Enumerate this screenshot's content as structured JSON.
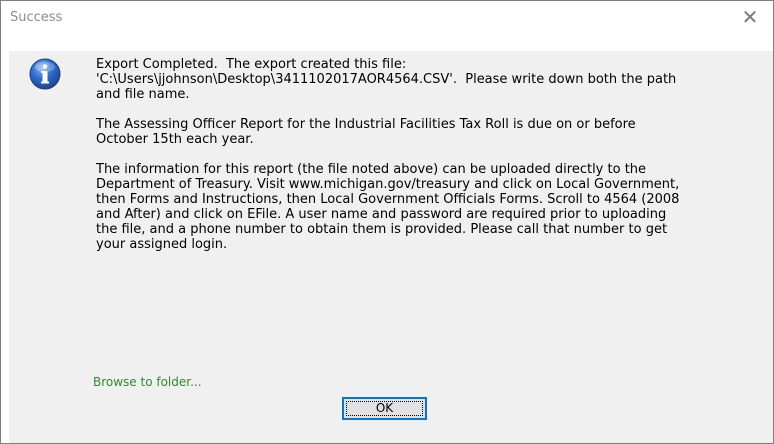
{
  "window": {
    "title": "Success",
    "close_glyph": "✕"
  },
  "icon": "information-icon",
  "message": {
    "paragraph1": "Export Completed.  The export created this file:\n'C:\\Users\\jjohnson\\Desktop\\3411102017AOR4564.CSV'.  Please write down both the path\nand file name.",
    "paragraph2": "The Assessing Officer Report for the Industrial Facilities Tax Roll is due on or before\nOctober 15th each year.",
    "paragraph3": "The information for this report (the file noted above) can be uploaded directly to the\nDepartment of Treasury. Visit www.michigan.gov/treasury and click on Local Government,\nthen Forms and Instructions, then Local Government Officials Forms. Scroll to 4564 (2008\nand After) and click on EFile. A user name and password are required prior to uploading\nthe file, and a phone number to obtain them is provided. Please call that number to get\nyour assigned login."
  },
  "browse_link": "Browse to folder...",
  "ok_label": "OK",
  "colors": {
    "link": "#2e8b2e",
    "focus_border": "#0078d7",
    "client_bg": "#f0f0f0"
  }
}
